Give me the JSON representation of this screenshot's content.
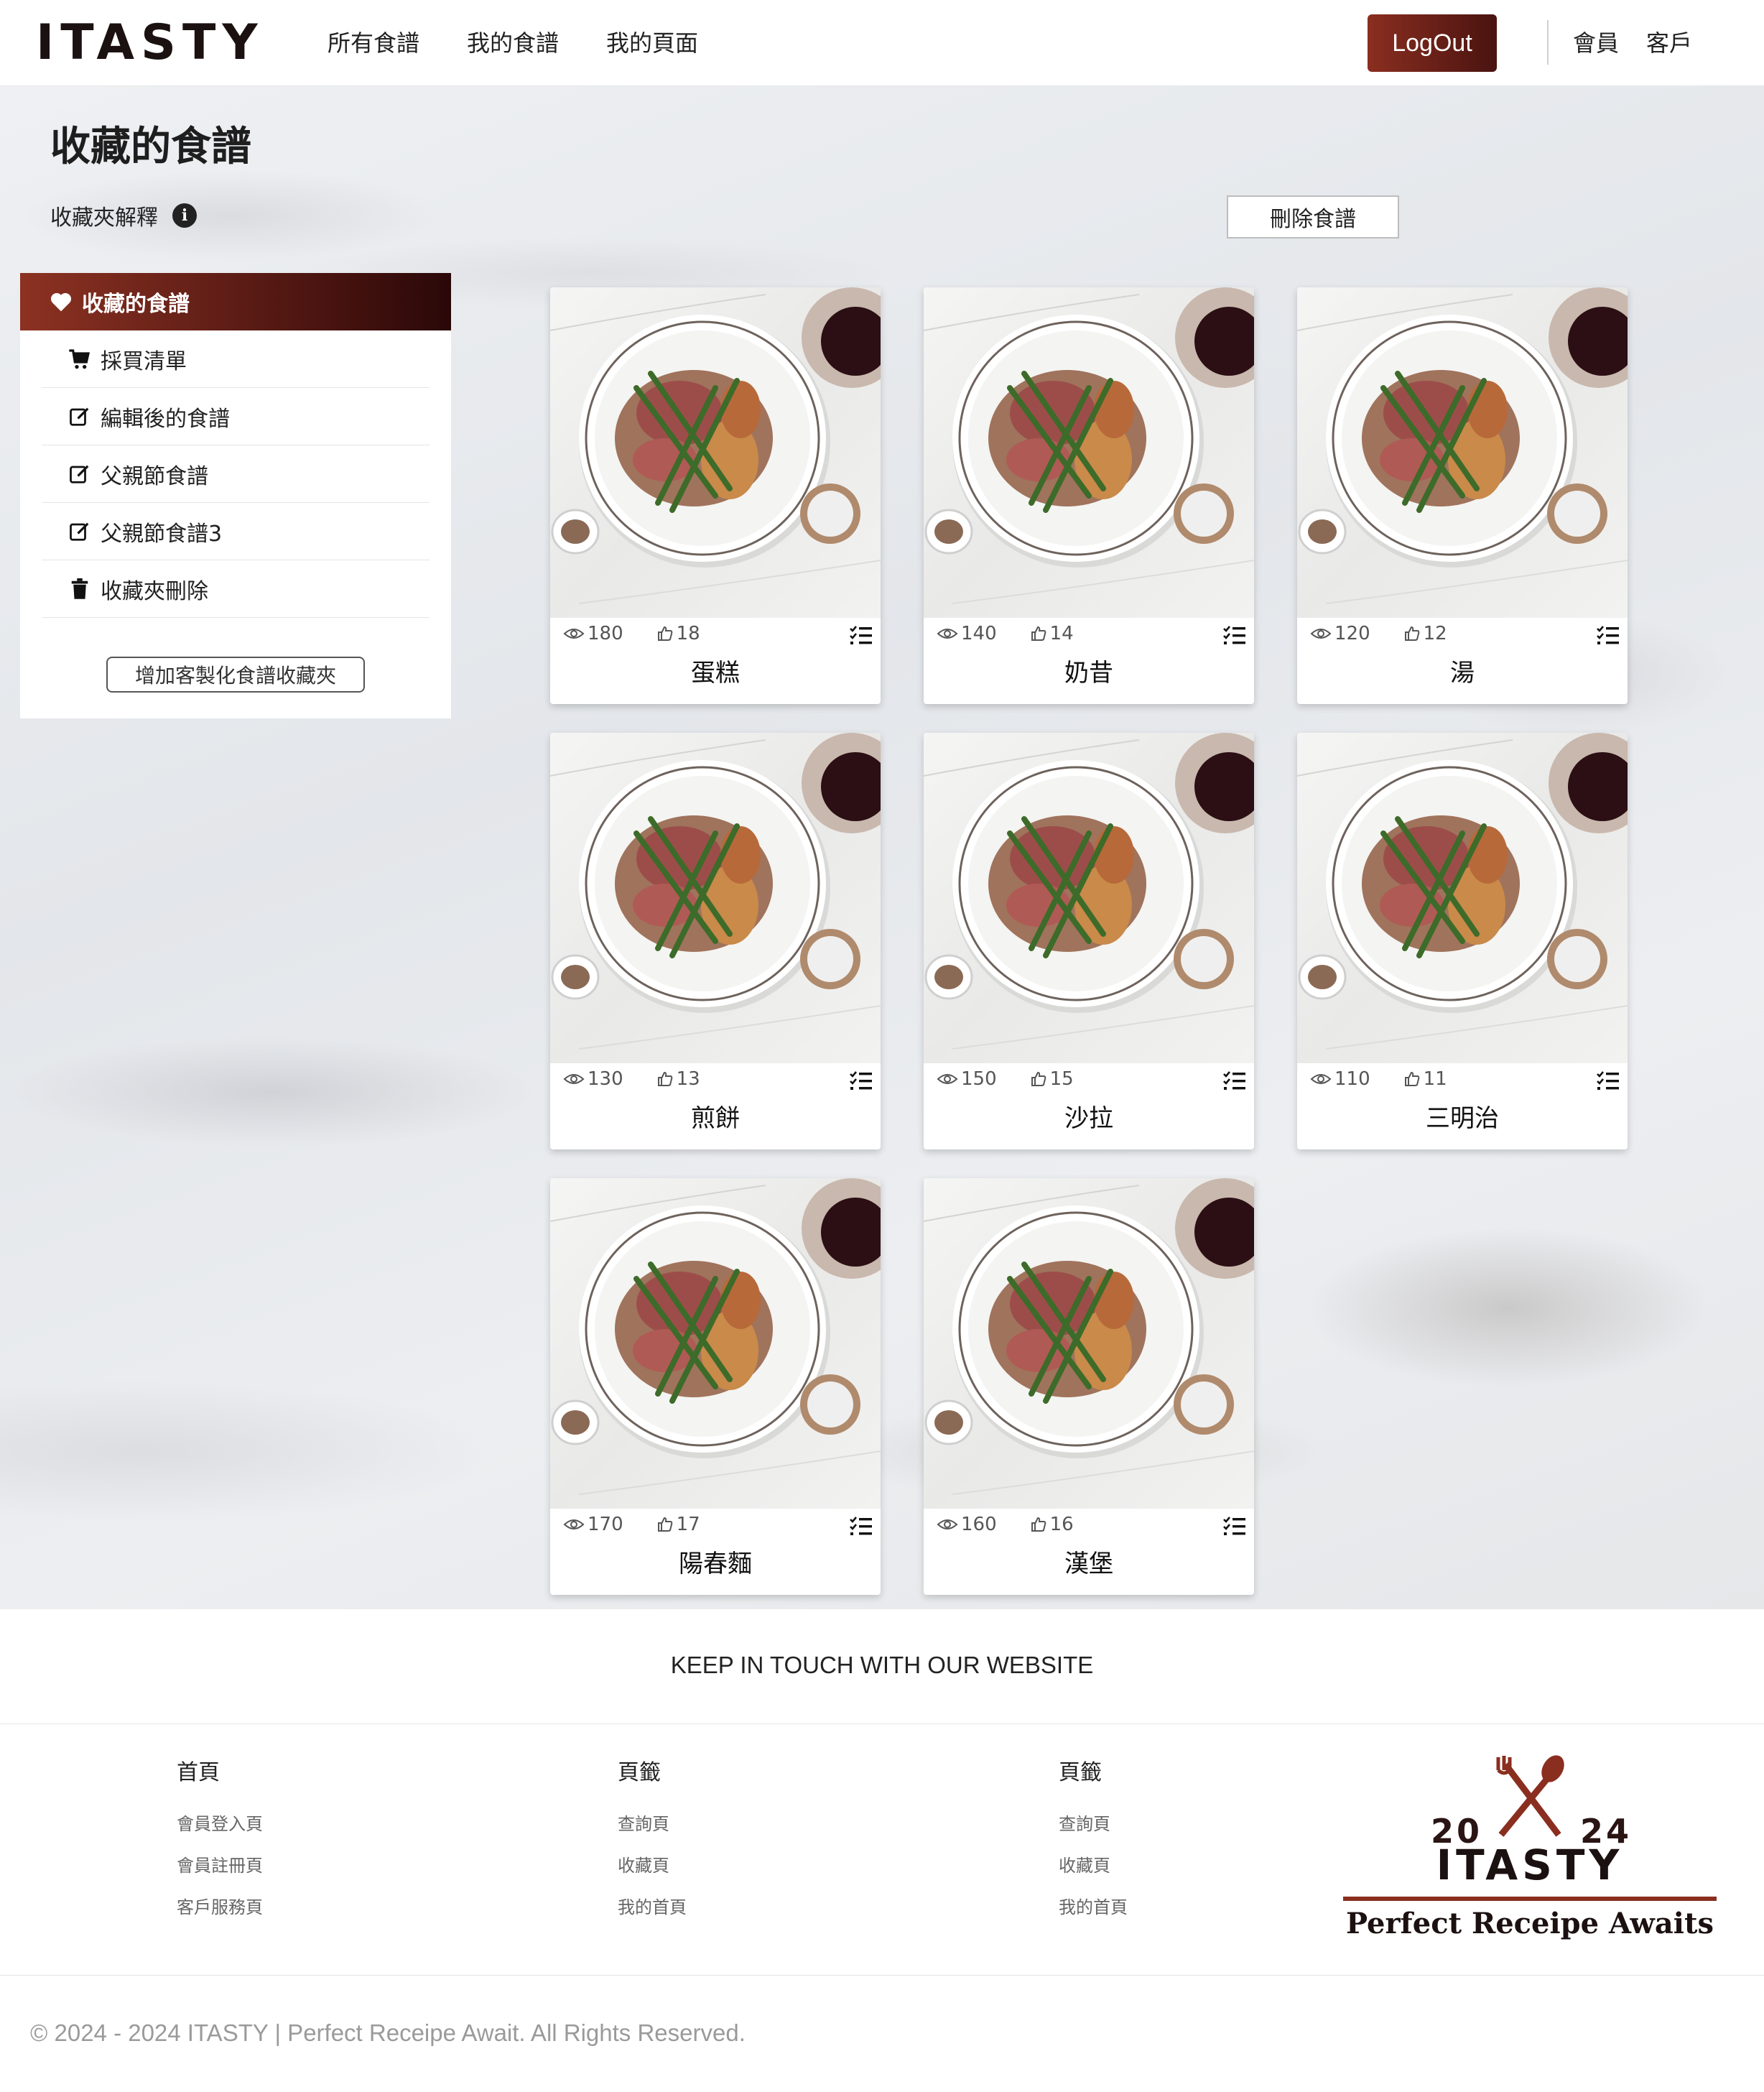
{
  "header": {
    "logo": "ITASTY",
    "nav": [
      "所有食譜",
      "我的食譜",
      "我的頁面"
    ],
    "logout_label": "LogOut",
    "links": [
      "會員",
      "客戶"
    ]
  },
  "page": {
    "title": "收藏的食譜",
    "folder_explain": "收藏夾解釋",
    "delete_label": "刪除食譜"
  },
  "sidebar": {
    "active_label": "收藏的食譜",
    "items": [
      {
        "label": "採買清單",
        "icon": "cart-icon"
      },
      {
        "label": "編輯後的食譜",
        "icon": "edit-icon"
      },
      {
        "label": "父親節食譜",
        "icon": "edit-icon"
      },
      {
        "label": "父親節食譜3",
        "icon": "edit-icon"
      },
      {
        "label": "收藏夾刪除",
        "icon": "trash-icon"
      }
    ],
    "add_label": "增加客製化食譜收藏夾"
  },
  "recipes": [
    {
      "name": "蛋糕",
      "views": "180",
      "likes": "18"
    },
    {
      "name": "奶昔",
      "views": "140",
      "likes": "14"
    },
    {
      "name": "湯",
      "views": "120",
      "likes": "12"
    },
    {
      "name": "煎餅",
      "views": "130",
      "likes": "13"
    },
    {
      "name": "沙拉",
      "views": "150",
      "likes": "15"
    },
    {
      "name": "三明治",
      "views": "110",
      "likes": "11"
    },
    {
      "name": "陽春麵",
      "views": "170",
      "likes": "17"
    },
    {
      "name": "漢堡",
      "views": "160",
      "likes": "16"
    }
  ],
  "footer": {
    "keep_touch": "KEEP IN TOUCH WITH OUR WEBSITE",
    "columns": [
      {
        "title": "首頁",
        "links": [
          "會員登入頁",
          "會員註冊頁",
          "客戶服務頁"
        ]
      },
      {
        "title": "頁籤",
        "links": [
          "查詢頁",
          "收藏頁",
          "我的首頁"
        ]
      },
      {
        "title": "頁籤",
        "links": [
          "查詢頁",
          "收藏頁",
          "我的首頁"
        ]
      }
    ],
    "badge": {
      "year_left": "20",
      "year_right": "24",
      "name": "ITASTY",
      "tagline": "Perfect Receipe Awaits"
    },
    "copyright": "© 2024 - 2024 ITASTY | Perfect Receipe Await. All Rights Reserved."
  },
  "colors": {
    "brand": "#8a2e20",
    "brand_dark": "#4a1310"
  }
}
